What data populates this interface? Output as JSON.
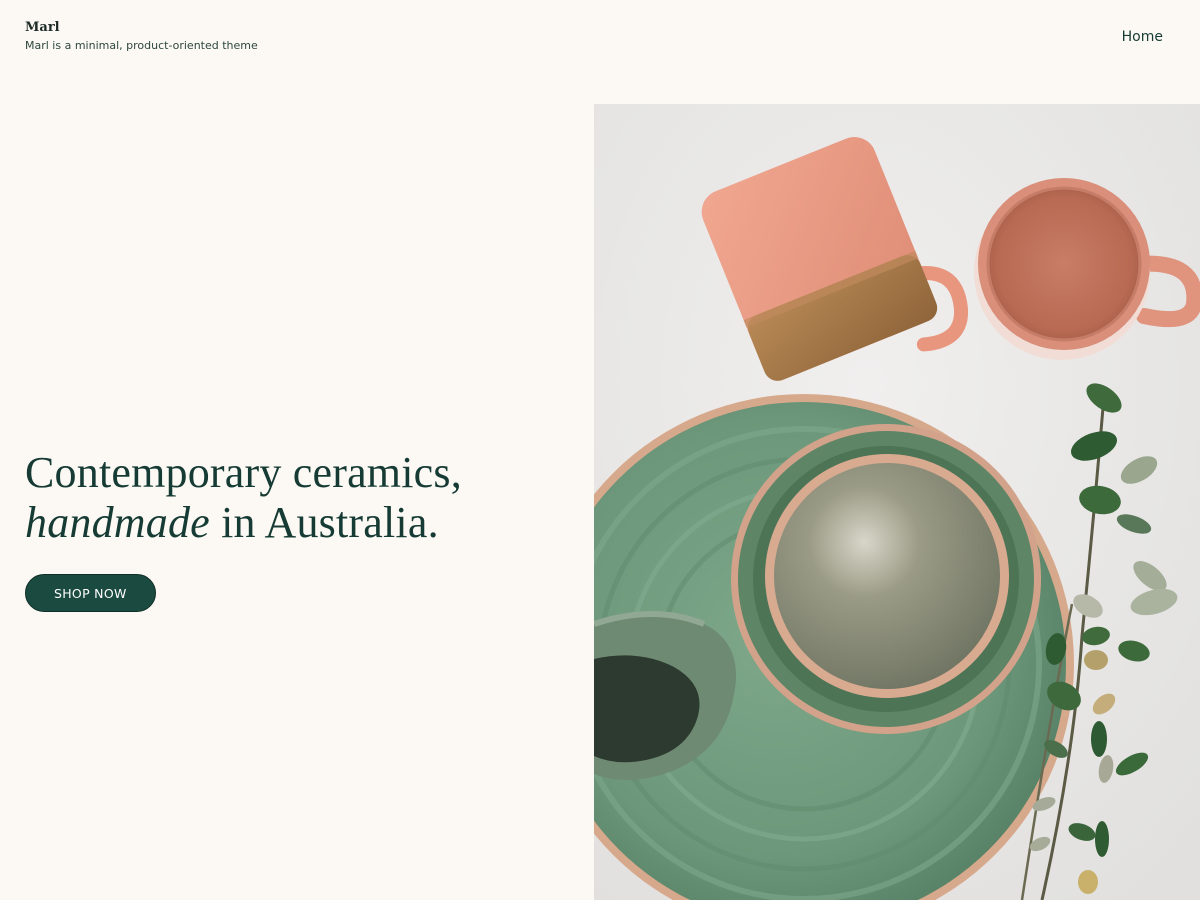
{
  "header": {
    "site_title": "Marl",
    "tagline": "Marl is a minimal, product-oriented theme",
    "nav": [
      {
        "label": "Home"
      }
    ]
  },
  "hero": {
    "heading_line1": "Contemporary ceramics,",
    "heading_line2_italic": "handmade",
    "heading_line2_rest": " in Australia.",
    "button_label": "SHOP NOW",
    "image_alt": "Handmade ceramic mugs, plates and bowls"
  },
  "colors": {
    "background": "#fcf9f4",
    "brand_green": "#1a4a40",
    "text": "#163b34"
  }
}
